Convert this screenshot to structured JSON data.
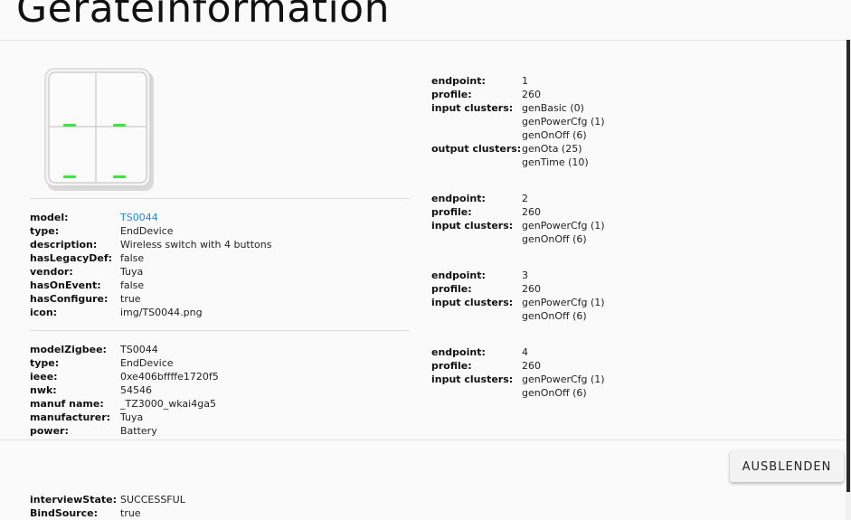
{
  "dialog": {
    "title": "Geräteinformation",
    "hide_button": "AUSBLENDEN"
  },
  "device_image": {
    "icon": "tuya-4-button-switch-image",
    "led_color": "#39e639"
  },
  "model_info": [
    {
      "key": "model:",
      "value": "TS0044",
      "link": true
    },
    {
      "key": "type:",
      "value": "EndDevice"
    },
    {
      "key": "description:",
      "value": "Wireless switch with 4 buttons"
    },
    {
      "key": "hasLegacyDef:",
      "value": "false"
    },
    {
      "key": "vendor:",
      "value": "Tuya"
    },
    {
      "key": "hasOnEvent:",
      "value": "false"
    },
    {
      "key": "hasConfigure:",
      "value": "true"
    },
    {
      "key": "icon:",
      "value": "img/TS0044.png"
    }
  ],
  "zigbee_info": [
    {
      "key": "modelZigbee:",
      "value": "TS0044"
    },
    {
      "key": "type:",
      "value": "EndDevice"
    },
    {
      "key": "ieee:",
      "value": "0xe406bffffe1720f5"
    },
    {
      "key": "nwk:",
      "value": "54546"
    },
    {
      "key": "manuf name:",
      "value": "_TZ3000_wkai4ga5"
    },
    {
      "key": "manufacturer:",
      "value": "Tuya"
    },
    {
      "key": "power:",
      "value": "Battery"
    }
  ],
  "below_footer": [
    {
      "key": "interviewState:",
      "value": "SUCCESSFUL"
    },
    {
      "key": "BindSource:",
      "value": "true"
    }
  ],
  "endpoints": [
    {
      "endpoint_label": "endpoint:",
      "endpoint": "1",
      "profile_label": "profile:",
      "profile": "260",
      "input_label": "input clusters:",
      "input": [
        "genBasic (0)",
        "genPowerCfg (1)",
        "genOnOff (6)"
      ],
      "output_label": "output clusters:",
      "output": [
        "genOta (25)",
        "genTime (10)"
      ]
    },
    {
      "endpoint_label": "endpoint:",
      "endpoint": "2",
      "profile_label": "profile:",
      "profile": "260",
      "input_label": "input clusters:",
      "input": [
        "genPowerCfg (1)",
        "genOnOff (6)"
      ]
    },
    {
      "endpoint_label": "endpoint:",
      "endpoint": "3",
      "profile_label": "profile:",
      "profile": "260",
      "input_label": "input clusters:",
      "input": [
        "genPowerCfg (1)",
        "genOnOff (6)"
      ]
    },
    {
      "endpoint_label": "endpoint:",
      "endpoint": "4",
      "profile_label": "profile:",
      "profile": "260",
      "input_label": "input clusters:",
      "input": [
        "genPowerCfg (1)",
        "genOnOff (6)"
      ]
    }
  ]
}
